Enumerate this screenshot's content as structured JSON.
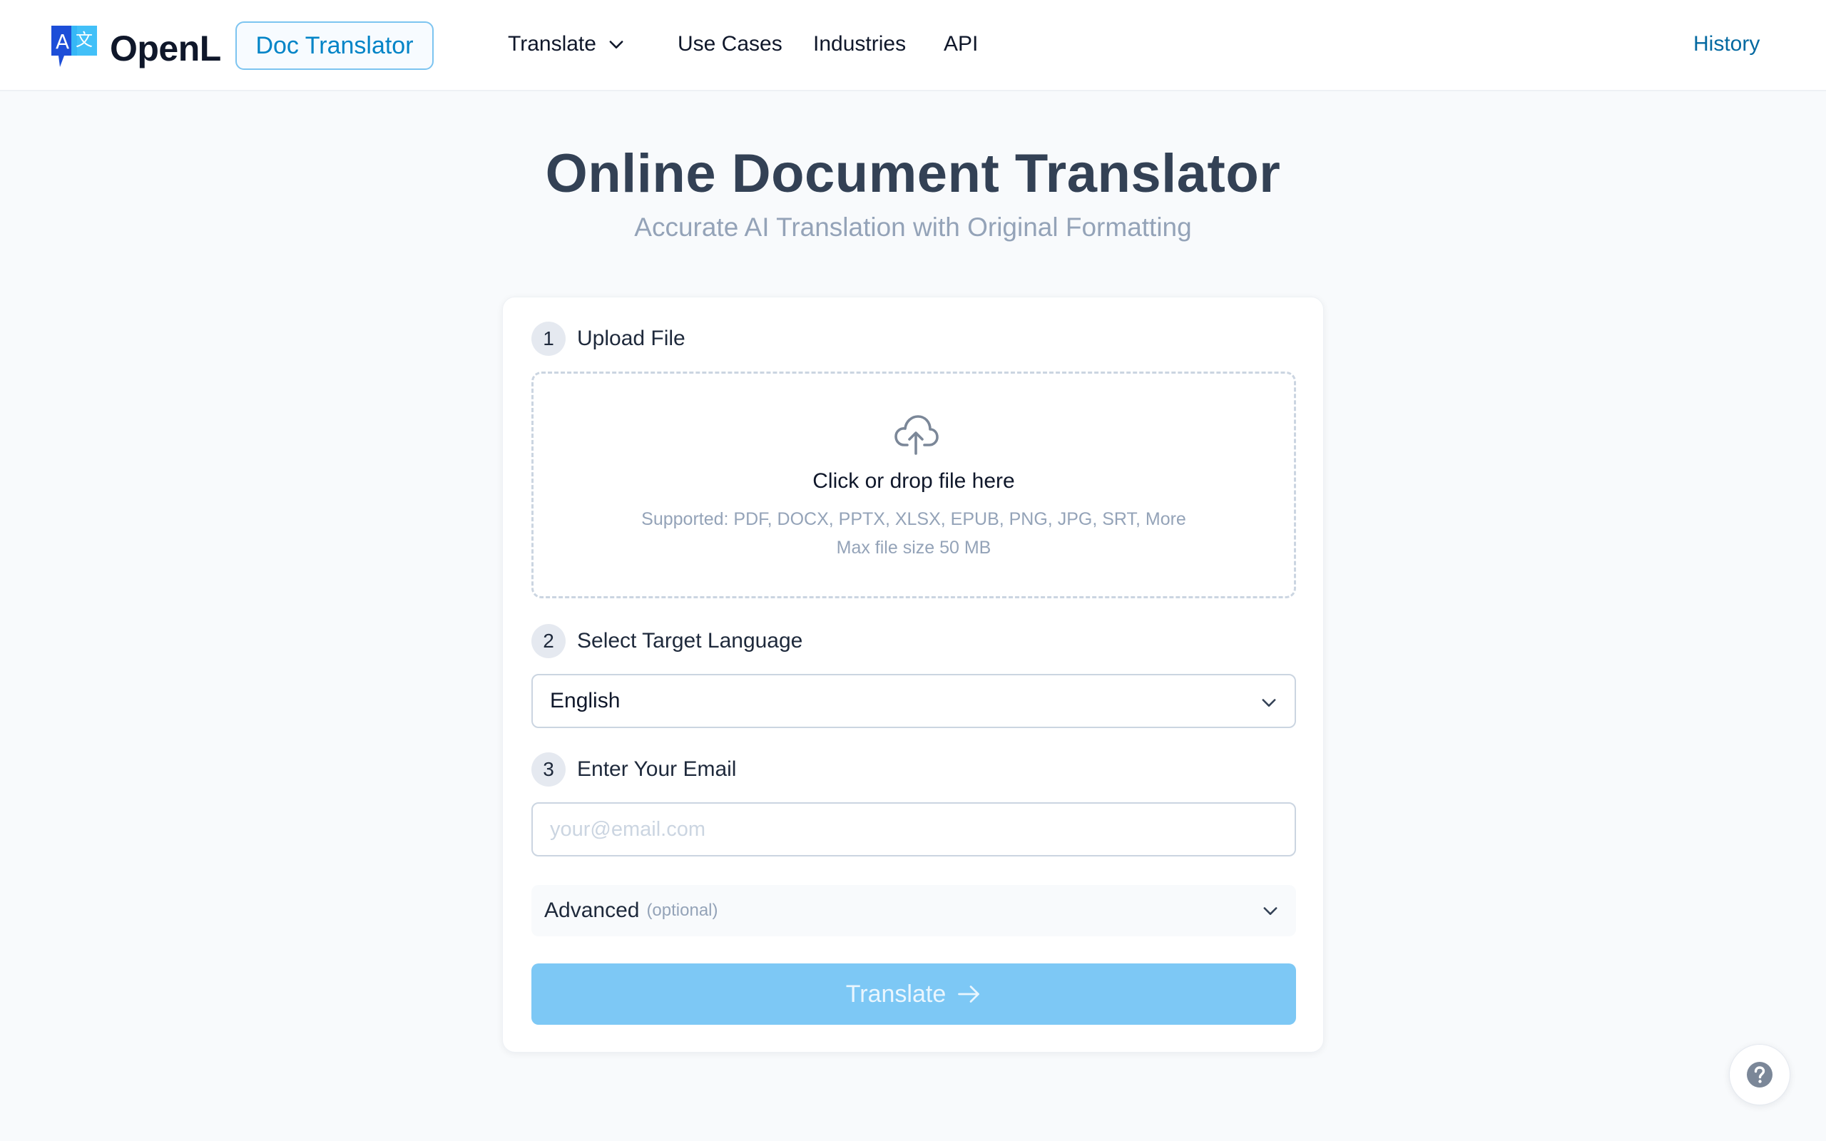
{
  "header": {
    "logo_text": "OpenL",
    "logo_glyph_a": "A",
    "logo_glyph_b": "文",
    "badge": "Doc Translator",
    "nav": {
      "translate": "Translate",
      "use_cases": "Use Cases",
      "industries": "Industries",
      "api": "API",
      "history": "History"
    }
  },
  "hero": {
    "title": "Online Document Translator",
    "subtitle": "Accurate AI Translation with Original Formatting"
  },
  "form": {
    "step1": {
      "num": "1",
      "label": "Upload File"
    },
    "dropzone": {
      "title": "Click or drop file here",
      "supported": "Supported: PDF, DOCX, PPTX, XLSX, EPUB, PNG, JPG, SRT, More",
      "max_size": "Max file size 50 MB"
    },
    "step2": {
      "num": "2",
      "label": "Select Target Language"
    },
    "language": {
      "selected": "English"
    },
    "step3": {
      "num": "3",
      "label": "Enter Your Email"
    },
    "email": {
      "value": "",
      "placeholder": "your@email.com"
    },
    "advanced": {
      "label": "Advanced",
      "optional": "(optional)"
    },
    "submit": "Translate"
  },
  "colors": {
    "accent": "#0284c7",
    "button": "#7dc8f5",
    "title": "#334155",
    "muted": "#94a3b8"
  },
  "icons": {
    "logo": "translate-bubble-icon",
    "nav_translate": "chevron-down-icon",
    "upload": "cloud-upload-icon",
    "language": "chevron-down-icon",
    "advanced": "chevron-down-icon",
    "submit": "arrow-right-icon",
    "help": "question-icon"
  }
}
